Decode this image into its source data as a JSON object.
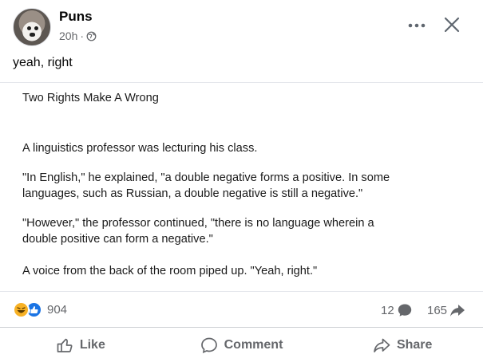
{
  "post": {
    "author": "Puns",
    "time": "20h",
    "separator": "·",
    "caption": "yeah, right"
  },
  "image_text": {
    "title": "Two Rights Make A Wrong",
    "lines": [
      "A linguistics professor was lecturing his class.",
      "\"In English,\" he explained, \"a double negative forms a positive.  In some",
      "languages, such as Russian, a double negative is still a negative.\"",
      "\"However,\" the professor continued, \"there is no language wherein a",
      "double positive can form a negative.\"",
      "A voice from the back of the room piped up.  \"Yeah, right.\""
    ]
  },
  "stats": {
    "reactions": "904",
    "comments": "12",
    "shares": "165"
  },
  "actions": {
    "like": "Like",
    "comment": "Comment",
    "share": "Share"
  },
  "icons": {
    "privacy": "globe-icon",
    "more": "more-options-icon",
    "close": "close-icon",
    "reaction_haha": "haha-reaction-icon",
    "reaction_like": "like-reaction-icon",
    "comment": "comment-icon",
    "share": "share-icon"
  },
  "colors": {
    "accent_like": "#1b74e4",
    "haha": "#f7b125",
    "secondary_text": "#65676b"
  }
}
